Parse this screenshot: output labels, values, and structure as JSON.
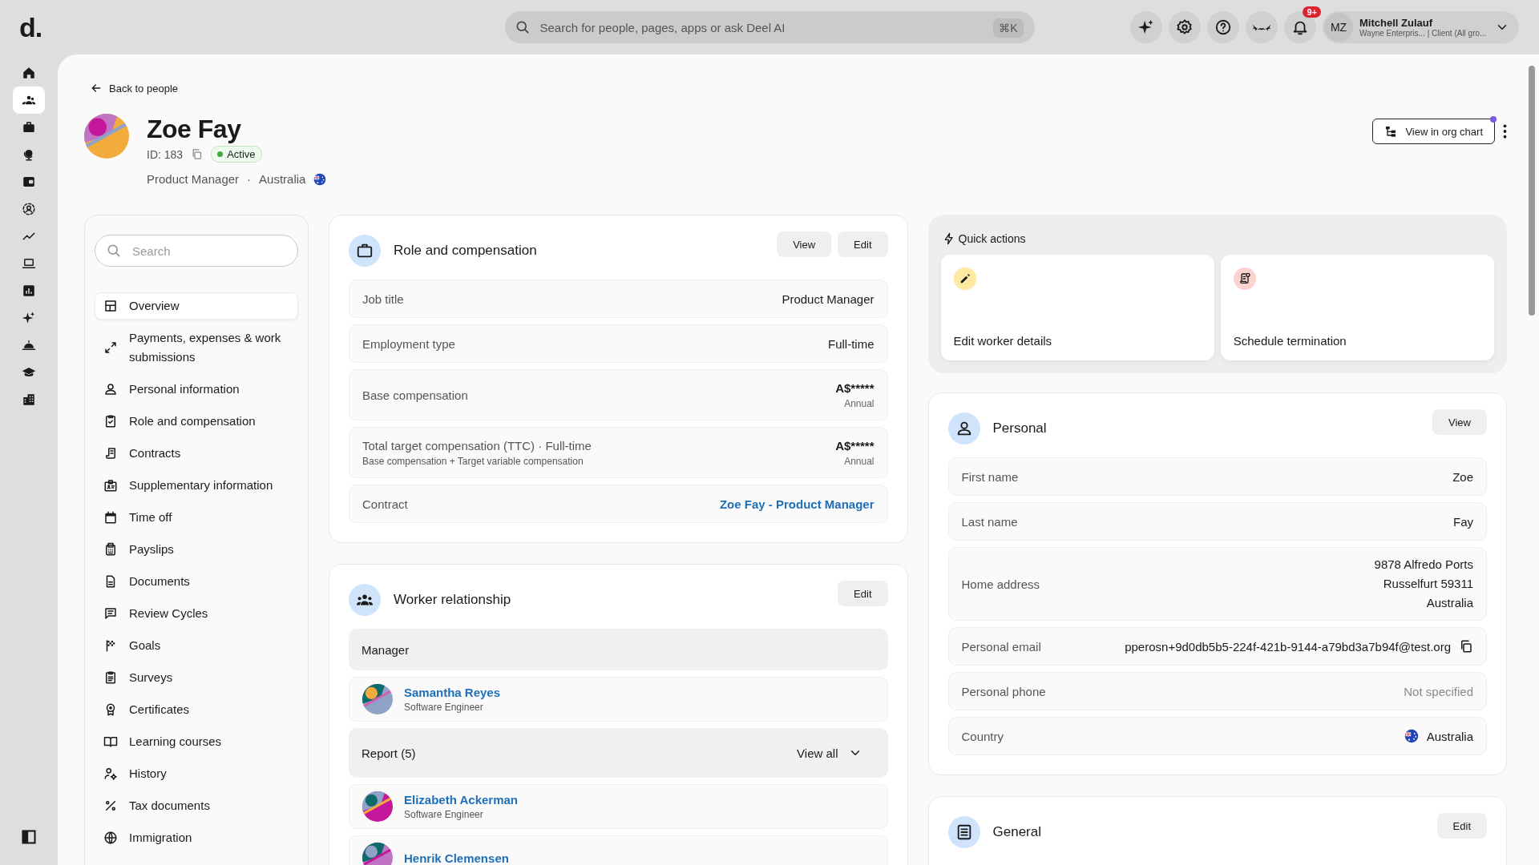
{
  "top_bar": {
    "logo": "d.",
    "search": {
      "placeholder": "Search for people, pages, apps or ask Deel AI",
      "shortcut": "⌘K"
    },
    "notification_count": "9+",
    "user": {
      "initials": "MZ",
      "name": "Mitchell Zulauf",
      "subtitle": "Wayne Enterpris... | Client (All gro..."
    }
  },
  "rail": {
    "items": [
      {
        "selected": false
      },
      {
        "selected": true
      },
      {
        "selected": false
      },
      {
        "selected": false
      },
      {
        "selected": false
      },
      {
        "selected": false
      },
      {
        "selected": false
      },
      {
        "selected": false
      },
      {
        "selected": false
      },
      {
        "selected": false
      },
      {
        "selected": false
      },
      {
        "selected": false
      },
      {
        "selected": false
      }
    ]
  },
  "header": {
    "back_link": "Back to people",
    "name": "Zoe Fay",
    "id": "ID: 183",
    "status": "Active",
    "job": "Product Manager",
    "separator": "·",
    "country": "Australia",
    "org_chart_button": "View in org chart"
  },
  "sidebar": {
    "search_placeholder": "Search",
    "items": [
      {
        "label": "Overview",
        "selected": true
      },
      {
        "label": "Payments, expenses & work submissions",
        "selected": false
      },
      {
        "label": "Personal information",
        "selected": false
      },
      {
        "label": "Role and compensation",
        "selected": false
      },
      {
        "label": "Contracts",
        "selected": false
      },
      {
        "label": "Supplementary information",
        "selected": false
      },
      {
        "label": "Time off",
        "selected": false
      },
      {
        "label": "Payslips",
        "selected": false
      },
      {
        "label": "Documents",
        "selected": false
      },
      {
        "label": "Review Cycles",
        "selected": false
      },
      {
        "label": "Goals",
        "selected": false
      },
      {
        "label": "Surveys",
        "selected": false
      },
      {
        "label": "Certificates",
        "selected": false
      },
      {
        "label": "Learning courses",
        "selected": false
      },
      {
        "label": "History",
        "selected": false
      },
      {
        "label": "Tax documents",
        "selected": false
      },
      {
        "label": "Immigration",
        "selected": false
      }
    ]
  },
  "role_card": {
    "title": "Role and compensation",
    "buttons": [
      "View",
      "Edit"
    ],
    "rows": [
      {
        "kind": "text",
        "label": "Job title",
        "value": "Product Manager"
      },
      {
        "kind": "text",
        "label": "Employment type",
        "value": "Full-time"
      },
      {
        "kind": "amount",
        "label": "Base compensation",
        "value": "A$*****",
        "note": "Annual"
      },
      {
        "kind": "amount",
        "label": "Total target compensation (TTC) · Full-time",
        "sublabel": "Base compensation + Target variable compensation",
        "value": "A$*****",
        "note": "Annual"
      },
      {
        "kind": "link",
        "label": "Contract",
        "value": "Zoe Fay - Product Manager"
      }
    ]
  },
  "worker_relationship": {
    "title": "Worker relationship",
    "buttons": [
      "Edit"
    ],
    "manager_heading": "Manager",
    "manager": {
      "name": "Samantha Reyes",
      "role": "Software Engineer"
    },
    "reports_heading": "Report (5)",
    "view_all": "View all",
    "reports": [
      {
        "name": "Elizabeth Ackerman",
        "role": "Software Engineer"
      },
      {
        "name": "Henrik Clemensen"
      }
    ]
  },
  "quick_actions": {
    "title": "Quick actions",
    "actions": [
      {
        "label": "Edit worker details",
        "color": "#fde9a0"
      },
      {
        "label": "Schedule termination",
        "color": "#fcd3cf"
      }
    ]
  },
  "personal": {
    "title": "Personal",
    "buttons": [
      "View"
    ],
    "rows": [
      {
        "kind": "text",
        "label": "First name",
        "value": "Zoe",
        "muted": false
      },
      {
        "kind": "text",
        "label": "Last name",
        "value": "Fay",
        "muted": false
      },
      {
        "kind": "address",
        "label": "Home address",
        "lines": [
          "9878 Alfredo Ports",
          "Russelfurt 59311",
          "Australia"
        ],
        "muted": false
      },
      {
        "kind": "email",
        "label": "Personal email",
        "value": "pperosn+9d0db5b5-224f-421b-9144-a79bd3a7b94f@test.org",
        "muted": false
      },
      {
        "kind": "text",
        "label": "Personal phone",
        "value": "Not specified",
        "muted": true
      },
      {
        "kind": "country",
        "label": "Country",
        "value": "Australia",
        "muted": false
      }
    ]
  },
  "general": {
    "title": "General",
    "buttons": [
      "Edit"
    ]
  }
}
